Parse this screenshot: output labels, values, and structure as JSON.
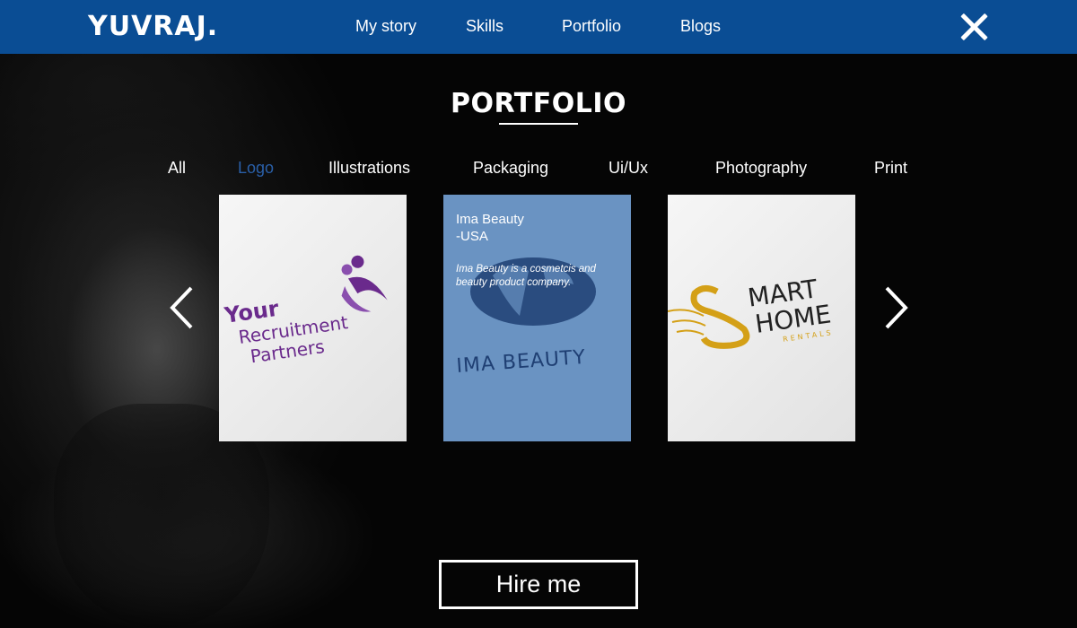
{
  "header": {
    "logo": "YUVRAJ.",
    "nav": [
      {
        "label": "My story"
      },
      {
        "label": "Skills"
      },
      {
        "label": "Portfolio"
      },
      {
        "label": "Blogs"
      }
    ],
    "close_icon": "close-x-icon",
    "bar_color": "#0a4d94"
  },
  "portfolio": {
    "title": "PORTFOLIO",
    "filters": [
      {
        "label": "All",
        "active": false
      },
      {
        "label": "Logo",
        "active": true
      },
      {
        "label": "Illustrations",
        "active": false
      },
      {
        "label": "Packaging",
        "active": false
      },
      {
        "label": "Ui/Ux",
        "active": false
      },
      {
        "label": "Photography",
        "active": false
      },
      {
        "label": "Print",
        "active": false
      }
    ],
    "active_color": "#2a5fa8",
    "cards": [
      {
        "logo_line1": "Your",
        "logo_line2": "Recruitment",
        "logo_line3": "Partners",
        "logo_color": "#6a2a8c"
      },
      {
        "title_line1": "Ima Beauty",
        "title_line2": "-USA",
        "description": "Ima Beauty is a cosmetcis and beauty product company.",
        "logo_text": "IMA BEAUTY",
        "logo_color": "#1f3f73"
      },
      {
        "logo_line1": "MART",
        "logo_line2": "HOME",
        "logo_line3": "RENTALS",
        "logo_color": "#222222",
        "accent_color": "#d4a017"
      }
    ],
    "prev_icon": "chevron-left-icon",
    "next_icon": "chevron-right-icon"
  },
  "cta": {
    "hire_label": "Hire me"
  }
}
